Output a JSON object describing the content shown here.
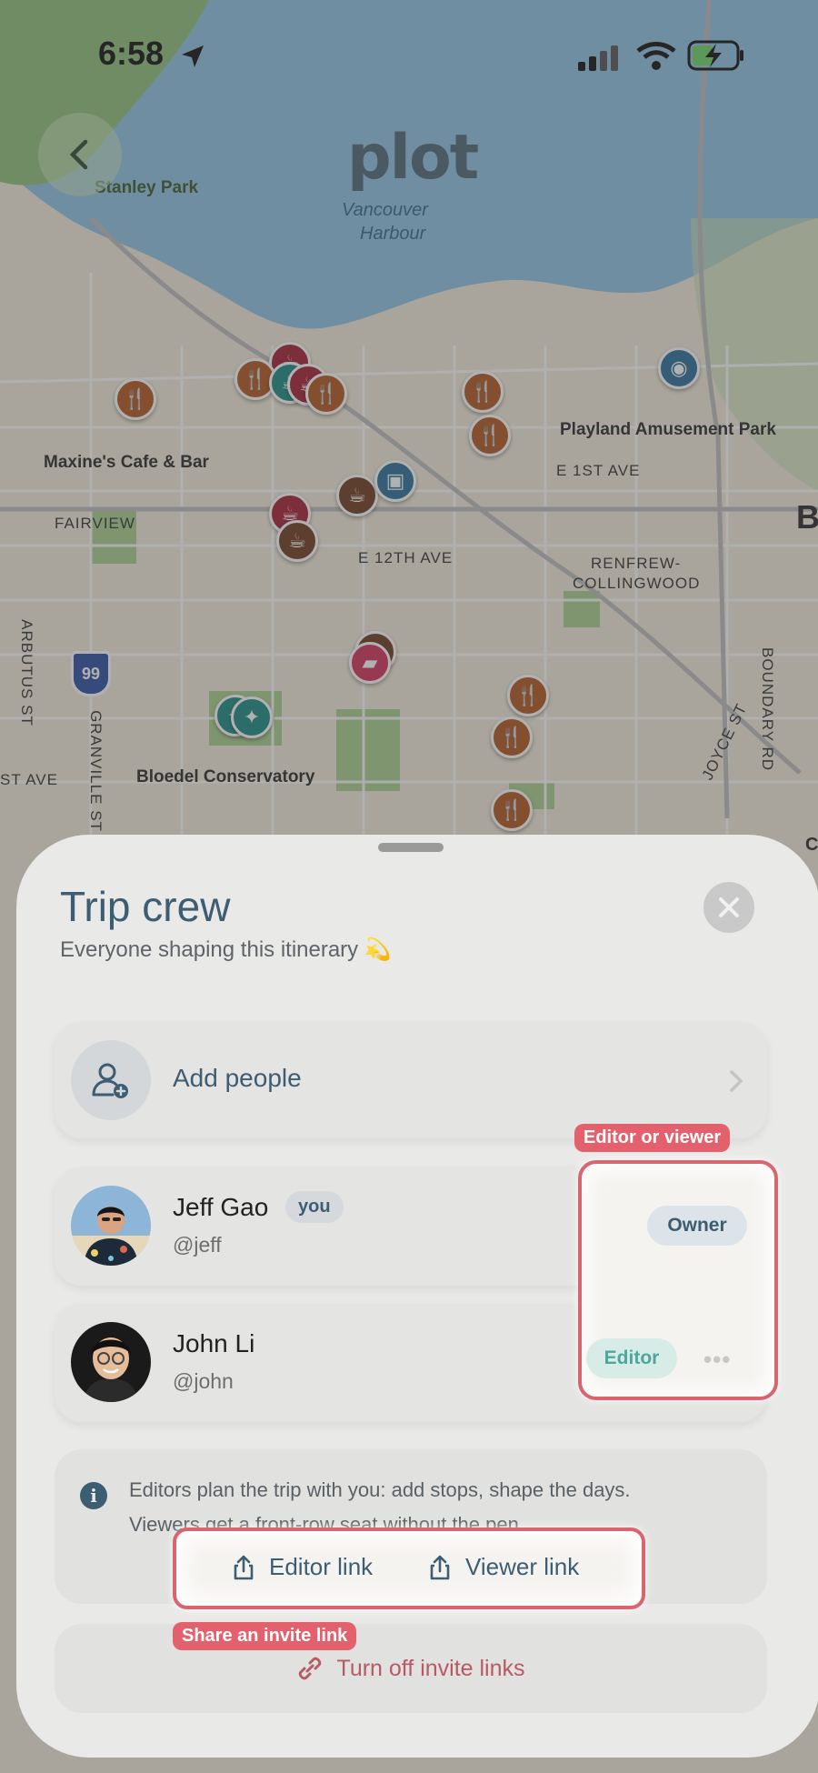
{
  "status_bar": {
    "time": "6:58"
  },
  "map": {
    "labels": {
      "stanley_park": "Stanley Park",
      "vancouver_harbour_1": "Vancouver",
      "vancouver_harbour_2": "Harbour",
      "playland": "Playland Amusement Park",
      "maxines": "Maxine's Cafe & Bar",
      "e_1st_ave": "E 1ST AVE",
      "fairview": "FAIRVIEW",
      "e_12th_ave": "E 12TH AVE",
      "renfrew_1": "RENFREW-",
      "renfrew_2": "COLLINGWOOD",
      "arbutus_st": "ARBUTUS ST",
      "granville": "GRANVILLE ST",
      "st_ave": "ST AVE",
      "bloedel": "Bloedel Conservatory",
      "joyce_st": "JOYCE ST",
      "boundary_rd": "BOUNDARY RD",
      "highway": "99",
      "edge_b": "B",
      "edge_c": "C"
    },
    "brand": "plot"
  },
  "sheet": {
    "title": "Trip crew",
    "subtitle": "Everyone shaping this itinerary 💫",
    "add_people_label": "Add people",
    "members": [
      {
        "name": "Jeff Gao",
        "handle": "@jeff",
        "you_badge": "you",
        "role": "Owner"
      },
      {
        "name": "John Li",
        "handle": "@john",
        "role": "Editor"
      }
    ],
    "info": {
      "line1": "Editors plan the trip with you: add stops, shape the days.",
      "line2": "Viewers get a front-row seat without the pen."
    },
    "share": {
      "editor_link": "Editor link",
      "viewer_link": "Viewer link"
    },
    "turn_off_label": "Turn off invite links"
  },
  "annotations": {
    "roles_tag": "Editor or viewer",
    "share_tag": "Share an invite link"
  },
  "colors": {
    "accent": "#3d5d72",
    "highlight": "#e2616d",
    "editor": "#4fa79b",
    "danger": "#b85a63"
  }
}
